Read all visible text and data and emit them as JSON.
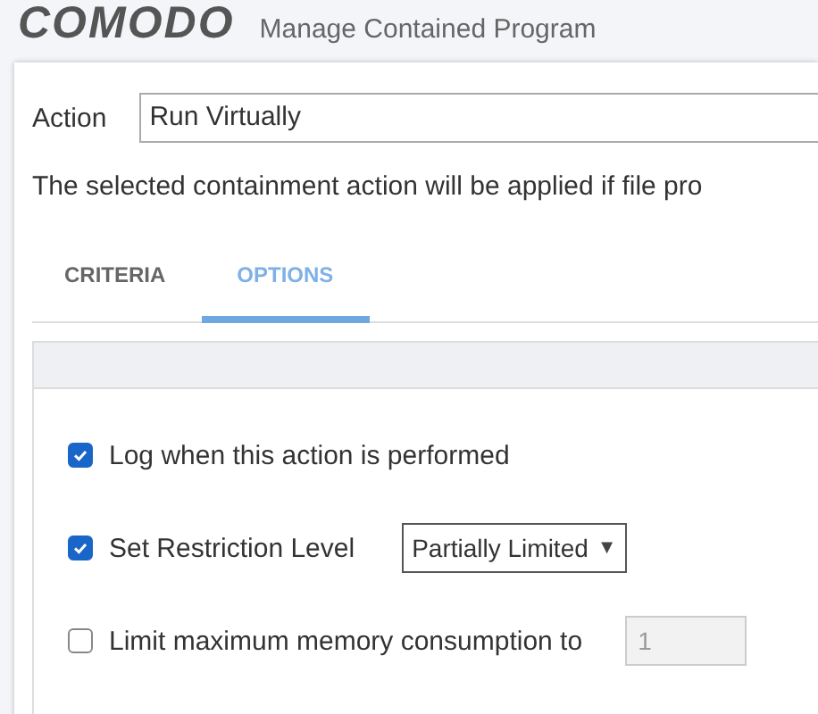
{
  "header": {
    "logo": "COMODO",
    "title": "Manage Contained Program"
  },
  "action": {
    "label": "Action",
    "value": "Run Virtually"
  },
  "description": "The selected containment action will be applied if file pro",
  "tabs": [
    {
      "label": "CRITERIA",
      "selected": false
    },
    {
      "label": "OPTIONS",
      "selected": true
    }
  ],
  "options": [
    {
      "kind": "checkbox",
      "label": "Log when this action is performed",
      "checked": true
    },
    {
      "kind": "select",
      "label": "Set Restriction Level",
      "checked": true,
      "value": "Partially Limited",
      "caret": "▼"
    },
    {
      "kind": "number",
      "label": "Limit maximum memory consumption to",
      "checked": false,
      "value": "1"
    }
  ]
}
